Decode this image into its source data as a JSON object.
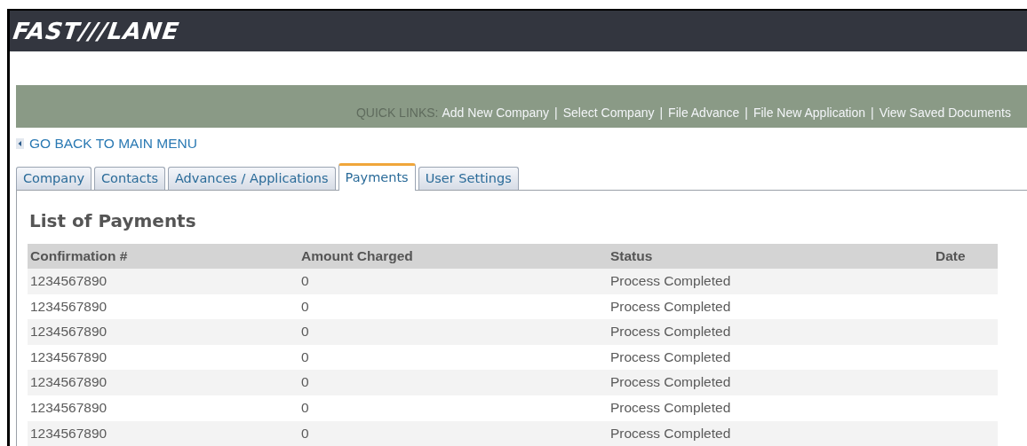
{
  "header": {
    "logo": "FAST///LANE"
  },
  "quick_links": {
    "label": "QUICK LINKS:",
    "items": [
      {
        "kind": "link",
        "text": "Add New Company"
      },
      {
        "kind": "separator",
        "text": "|"
      },
      {
        "kind": "link",
        "text": "Select Company"
      },
      {
        "kind": "separator",
        "text": "|"
      },
      {
        "kind": "link",
        "text": "File Advance"
      },
      {
        "kind": "separator",
        "text": "|"
      },
      {
        "kind": "link",
        "text": "File New Application"
      },
      {
        "kind": "separator",
        "text": "|"
      },
      {
        "kind": "link",
        "text": "View Saved Documents"
      }
    ]
  },
  "back_link": "GO BACK TO MAIN MENU",
  "tabs": [
    {
      "label": "Company",
      "selected": false
    },
    {
      "label": "Contacts",
      "selected": false
    },
    {
      "label": "Advances / Applications",
      "selected": false
    },
    {
      "label": "Payments",
      "selected": true
    },
    {
      "label": "User Settings",
      "selected": false
    }
  ],
  "title": "List of Payments",
  "table": {
    "columns": [
      "Confirmation #",
      "Amount Charged",
      "Status",
      "Date"
    ],
    "rows": [
      [
        "1234567890",
        "0",
        "Process Completed"
      ],
      [
        "1234567890",
        "0",
        "Process Completed"
      ],
      [
        "1234567890",
        "0",
        "Process Completed"
      ],
      [
        "1234567890",
        "0",
        "Process Completed"
      ],
      [
        "1234567890",
        "0",
        "Process Completed"
      ],
      [
        "1234567890",
        "0",
        "Process Completed"
      ],
      [
        "1234567890",
        "0",
        "Process Completed"
      ]
    ]
  }
}
